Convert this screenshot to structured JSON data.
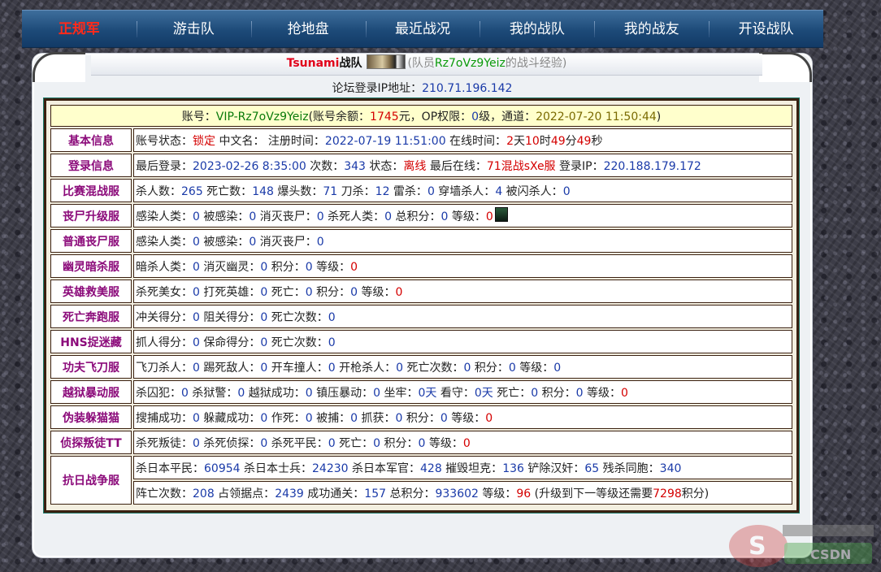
{
  "nav": {
    "items": [
      "正规军",
      "游击队",
      "抢地盘",
      "最近战况",
      "我的战队",
      "我的战友",
      "开设战队"
    ],
    "active": 0
  },
  "header": {
    "team": "Tsunami",
    "team_suffix": "战队",
    "member_prefix": "(队员",
    "member": "Rz7oVz9Yeiz",
    "member_suffix": "的战斗经验)"
  },
  "ip_line": {
    "label": "论坛登录IP地址：",
    "ip": "210.71.196.142"
  },
  "account": {
    "p1": "账号：",
    "id": "VIP-Rz7oVz9Yeiz",
    "p2": "(账号余额：",
    "balance": "1745",
    "p3": "元，OP权限：",
    "op": "0",
    "p4": "级，通道：",
    "channel_time": "2022-07-20 11:50:44",
    "p5": ")"
  },
  "rows": [
    {
      "label": "基本信息",
      "parts": [
        [
          "账号状态：",
          "k"
        ],
        [
          "锁定",
          "r"
        ],
        [
          " 中文名： 注册时间：",
          "k"
        ],
        [
          "2022-07-19 11:51:00",
          "b"
        ],
        [
          " 在线时间：",
          "k"
        ],
        [
          "2",
          "r"
        ],
        [
          "天",
          "k"
        ],
        [
          "10",
          "r"
        ],
        [
          "时",
          "k"
        ],
        [
          "49",
          "r"
        ],
        [
          "分",
          "k"
        ],
        [
          "49",
          "r"
        ],
        [
          "秒",
          "k"
        ]
      ]
    },
    {
      "label": "登录信息",
      "parts": [
        [
          "最后登录：",
          "k"
        ],
        [
          "2023-02-26 8:35:00",
          "b"
        ],
        [
          " 次数：",
          "k"
        ],
        [
          "343",
          "b"
        ],
        [
          " 状态：",
          "k"
        ],
        [
          "离线",
          "r"
        ],
        [
          " 最后在线：",
          "k"
        ],
        [
          "71混战sXe服",
          "r"
        ],
        [
          " 登录IP：",
          "k"
        ],
        [
          "220.188.179.172",
          "b"
        ]
      ]
    },
    {
      "label": "比赛混战服",
      "parts": [
        [
          "杀人数：",
          "k"
        ],
        [
          "265",
          "b"
        ],
        [
          " 死亡数：",
          "k"
        ],
        [
          "148",
          "b"
        ],
        [
          " 爆头数：",
          "k"
        ],
        [
          "71",
          "b"
        ],
        [
          " 刀杀：",
          "k"
        ],
        [
          "12",
          "b"
        ],
        [
          " 雷杀：",
          "k"
        ],
        [
          "0",
          "b"
        ],
        [
          " 穿墙杀人：",
          "k"
        ],
        [
          "4",
          "b"
        ],
        [
          " 被闪杀人：",
          "k"
        ],
        [
          "0",
          "b"
        ]
      ]
    },
    {
      "label": "丧尸升级服",
      "avatar": true,
      "parts": [
        [
          "感染人类：",
          "k"
        ],
        [
          "0",
          "b"
        ],
        [
          " 被感染：",
          "k"
        ],
        [
          "0",
          "b"
        ],
        [
          " 消灭丧尸：",
          "k"
        ],
        [
          "0",
          "b"
        ],
        [
          " 杀死人类：",
          "k"
        ],
        [
          "0",
          "b"
        ],
        [
          " 总积分：",
          "k"
        ],
        [
          "0",
          "b"
        ],
        [
          " 等级：",
          "k"
        ],
        [
          "0",
          "r"
        ]
      ]
    },
    {
      "label": "普通丧尸服",
      "parts": [
        [
          "感染人类：",
          "k"
        ],
        [
          "0",
          "b"
        ],
        [
          " 被感染：",
          "k"
        ],
        [
          "0",
          "b"
        ],
        [
          " 消灭丧尸：",
          "k"
        ],
        [
          "0",
          "b"
        ]
      ]
    },
    {
      "label": "幽灵暗杀服",
      "parts": [
        [
          "暗杀人类：",
          "k"
        ],
        [
          "0",
          "b"
        ],
        [
          " 消灭幽灵：",
          "k"
        ],
        [
          "0",
          "b"
        ],
        [
          " 积分：",
          "k"
        ],
        [
          "0",
          "b"
        ],
        [
          " 等级：",
          "k"
        ],
        [
          "0",
          "r"
        ]
      ]
    },
    {
      "label": "英雄救美服",
      "parts": [
        [
          "杀死美女：",
          "k"
        ],
        [
          "0",
          "b"
        ],
        [
          " 打死英雄：",
          "k"
        ],
        [
          "0",
          "b"
        ],
        [
          " 死亡：",
          "k"
        ],
        [
          "0",
          "b"
        ],
        [
          " 积分：",
          "k"
        ],
        [
          "0",
          "b"
        ],
        [
          " 等级：",
          "k"
        ],
        [
          "0",
          "r"
        ]
      ]
    },
    {
      "label": "死亡奔跑服",
      "parts": [
        [
          "冲关得分：",
          "k"
        ],
        [
          "0",
          "b"
        ],
        [
          " 阻关得分：",
          "k"
        ],
        [
          "0",
          "b"
        ],
        [
          " 死亡次数：",
          "k"
        ],
        [
          "0",
          "b"
        ]
      ]
    },
    {
      "label": "HNS捉迷藏",
      "parts": [
        [
          "抓人得分：",
          "k"
        ],
        [
          "0",
          "b"
        ],
        [
          " 保命得分：",
          "k"
        ],
        [
          "0",
          "b"
        ],
        [
          " 死亡次数：",
          "k"
        ],
        [
          "0",
          "b"
        ]
      ]
    },
    {
      "label": "功夫飞刀服",
      "parts": [
        [
          "飞刀杀人：",
          "k"
        ],
        [
          "0",
          "b"
        ],
        [
          " 踢死敌人：",
          "k"
        ],
        [
          "0",
          "b"
        ],
        [
          " 开车撞人：",
          "k"
        ],
        [
          "0",
          "b"
        ],
        [
          " 开枪杀人：",
          "k"
        ],
        [
          "0",
          "b"
        ],
        [
          " 死亡次数：",
          "k"
        ],
        [
          "0",
          "b"
        ],
        [
          " 积分：",
          "k"
        ],
        [
          "0",
          "b"
        ],
        [
          " 等级：",
          "k"
        ],
        [
          "0",
          "b"
        ]
      ]
    },
    {
      "label": "越狱暴动服",
      "parts": [
        [
          "杀囚犯：",
          "k"
        ],
        [
          "0",
          "b"
        ],
        [
          " 杀狱警：",
          "k"
        ],
        [
          "0",
          "b"
        ],
        [
          " 越狱成功：",
          "k"
        ],
        [
          "0",
          "b"
        ],
        [
          " 镇压暴动：",
          "k"
        ],
        [
          "0",
          "b"
        ],
        [
          " 坐牢：",
          "k"
        ],
        [
          "0天",
          "b"
        ],
        [
          " 看守：",
          "k"
        ],
        [
          "0天",
          "b"
        ],
        [
          " 死亡：",
          "k"
        ],
        [
          "0",
          "b"
        ],
        [
          " 积分：",
          "k"
        ],
        [
          "0",
          "b"
        ],
        [
          " 等级：",
          "k"
        ],
        [
          "0",
          "r"
        ]
      ]
    },
    {
      "label": "伪装躲猫猫",
      "parts": [
        [
          "搜捕成功：",
          "k"
        ],
        [
          "0",
          "b"
        ],
        [
          " 躲藏成功：",
          "k"
        ],
        [
          "0",
          "b"
        ],
        [
          " 作死：",
          "k"
        ],
        [
          "0",
          "b"
        ],
        [
          " 被捕：",
          "k"
        ],
        [
          "0",
          "b"
        ],
        [
          " 抓获：",
          "k"
        ],
        [
          "0",
          "b"
        ],
        [
          " 积分：",
          "k"
        ],
        [
          "0",
          "b"
        ],
        [
          " 等级：",
          "k"
        ],
        [
          "0",
          "r"
        ]
      ]
    },
    {
      "label": "侦探叛徒TT",
      "parts": [
        [
          "杀死叛徒：",
          "k"
        ],
        [
          "0",
          "b"
        ],
        [
          " 杀死侦探：",
          "k"
        ],
        [
          "0",
          "b"
        ],
        [
          " 杀死平民：",
          "k"
        ],
        [
          "0",
          "b"
        ],
        [
          " 死亡：",
          "k"
        ],
        [
          "0",
          "b"
        ],
        [
          " 积分：",
          "k"
        ],
        [
          "0",
          "b"
        ],
        [
          " 等级：",
          "k"
        ],
        [
          "0",
          "r"
        ]
      ]
    }
  ],
  "anti_japan": {
    "label": "抗日战争服",
    "line1": [
      [
        "杀日本平民：",
        "k"
      ],
      [
        "60954",
        "b"
      ],
      [
        " 杀日本士兵：",
        "k"
      ],
      [
        "24230",
        "b"
      ],
      [
        " 杀日本军官：",
        "k"
      ],
      [
        "428",
        "b"
      ],
      [
        " 摧毁坦克：",
        "k"
      ],
      [
        "136",
        "b"
      ],
      [
        " 铲除汉奸：",
        "k"
      ],
      [
        "65",
        "b"
      ],
      [
        " 残杀同胞：",
        "k"
      ],
      [
        "340",
        "b"
      ]
    ],
    "line2": [
      [
        "阵亡次数：",
        "k"
      ],
      [
        "208",
        "b"
      ],
      [
        " 占领据点：",
        "k"
      ],
      [
        "2439",
        "b"
      ],
      [
        " 成功通关：",
        "k"
      ],
      [
        "157",
        "b"
      ],
      [
        " 总积分：",
        "k"
      ],
      [
        "933602",
        "b"
      ],
      [
        " 等级：",
        "k"
      ],
      [
        "96",
        "r"
      ],
      [
        " (升级到下一等级还需要",
        "k"
      ],
      [
        "7298",
        "r"
      ],
      [
        "积分)",
        "k"
      ]
    ]
  },
  "watermark": "CSDN"
}
